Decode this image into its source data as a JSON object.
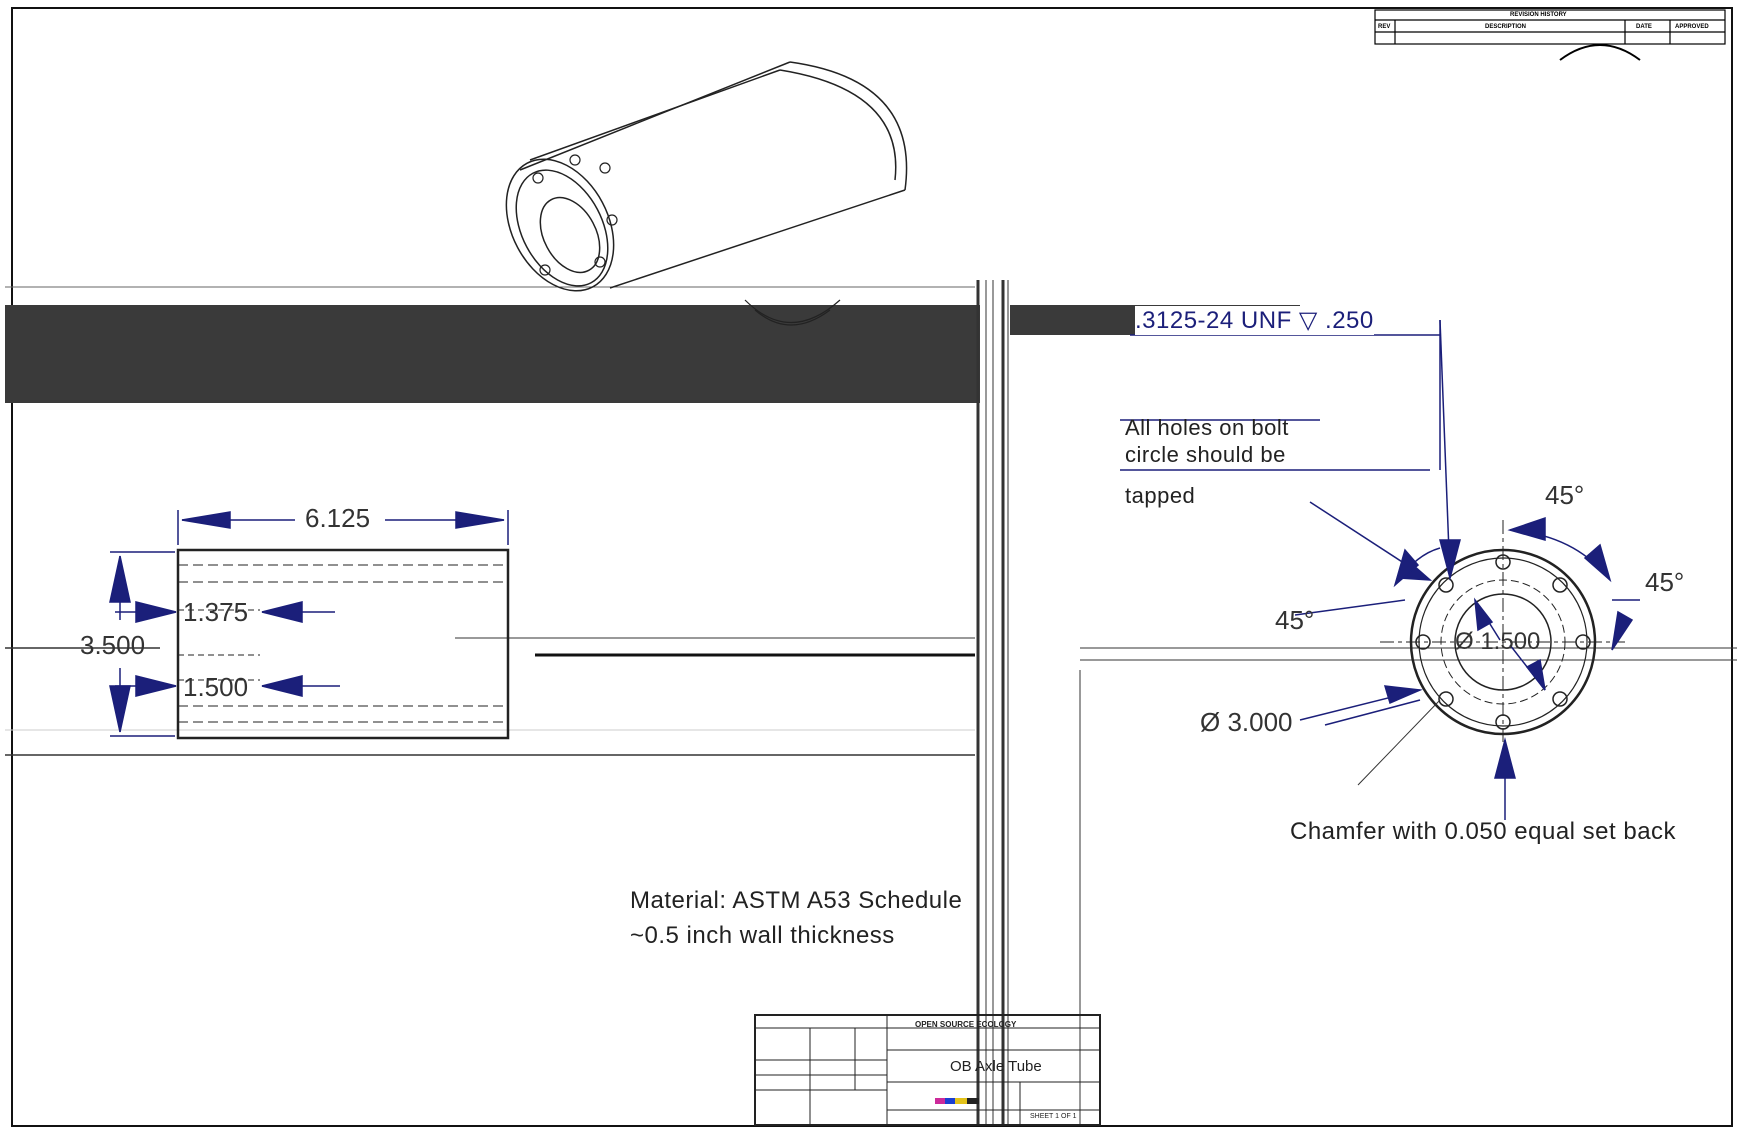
{
  "revision_block": {
    "title": "REVISION HISTORY",
    "col_rev": "REV",
    "col_description": "DESCRIPTION",
    "col_date": "DATE",
    "col_approved": "APPROVED"
  },
  "dimensions": {
    "overall_length": "6.125",
    "inner_diameter": "1.375",
    "outer_diameter": "3.500",
    "hole_offset": "1.500",
    "bolt_circle": "Ø 3.000",
    "center_bore": "Ø 1.500",
    "angle_top": "45°",
    "angle_right": "45°",
    "angle_left": "45°"
  },
  "notes": {
    "thread_callout": ".3125-24 UNF ▽ .250",
    "holes_note_line1": "All holes on bolt",
    "holes_note_line2": "circle should be",
    "holes_note_line3": "tapped",
    "chamfer_note": "Chamfer with 0.050 equal set back",
    "material_line1": "Material: ASTM A53 Schedule",
    "material_line2": "~0.5 inch wall thickness"
  },
  "title_block": {
    "part_name": "OB Axle Tube",
    "company": "OPEN SOURCE ECOLOGY",
    "sheet": "SHEET 1 OF 1"
  },
  "colors": {
    "line": "#1a1a1a",
    "dim_arrow": "#1b1f7a",
    "dark_band": "#3a3a3a",
    "background": "#ffffff"
  }
}
